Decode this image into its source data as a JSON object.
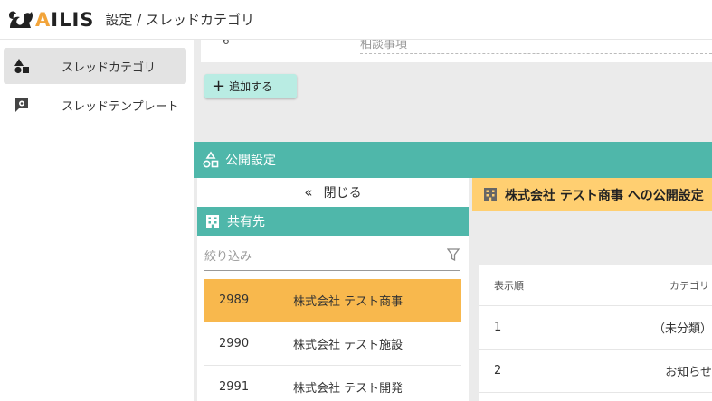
{
  "header": {
    "logo_text_a": "A",
    "logo_text_rest": "ILIS",
    "title": "設定 / スレッドカテゴリ"
  },
  "sidebar": {
    "items": [
      {
        "label": "スレッドカテゴリ",
        "icon": "shapes-icon",
        "active": true
      },
      {
        "label": "スレッドテンプレート",
        "icon": "template-gear-icon",
        "active": false
      }
    ]
  },
  "category_row": {
    "number": "6",
    "name": "相談事項"
  },
  "add_button": {
    "label": "追加する"
  },
  "public_settings": {
    "title": "公開設定",
    "close_label": "閉じる",
    "share_title": "共有先",
    "filter_placeholder": "絞り込み",
    "companies": [
      {
        "code": "2989",
        "name": "株式会社 テスト商事",
        "selected": true
      },
      {
        "code": "2990",
        "name": "株式会社 テスト施設",
        "selected": false
      },
      {
        "code": "2991",
        "name": "株式会社 テスト開発",
        "selected": false
      }
    ],
    "company_header": "株式会社 テスト商事 への公開設定",
    "table": {
      "columns": [
        "表示順",
        "カテゴリ"
      ],
      "rows": [
        {
          "order": "1",
          "category": "（未分類）"
        },
        {
          "order": "2",
          "category": "お知らせ"
        }
      ]
    }
  },
  "colors": {
    "teal": "#4fb7aa",
    "orange_selected": "#f8b84d",
    "yellow_header": "#ffcf71",
    "add_button": "#b9ece3"
  }
}
